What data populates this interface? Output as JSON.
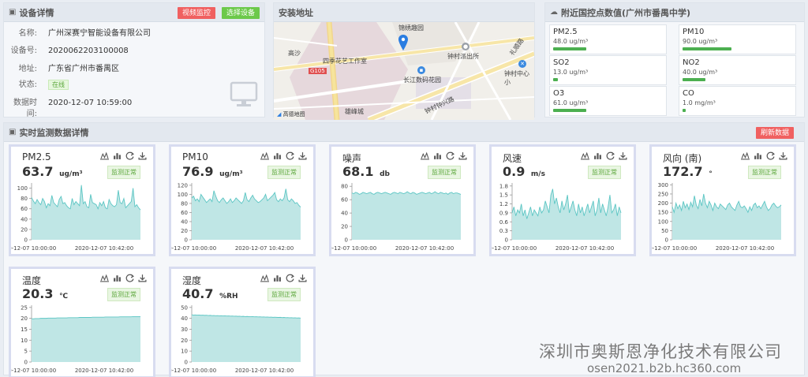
{
  "device": {
    "title": "设备详情",
    "btn_video": "视频监控",
    "btn_select": "选择设备",
    "rows": [
      {
        "label": "名称:",
        "value": "广州深赛宁智能设备有限公司"
      },
      {
        "label": "设备号:",
        "value": "2020062203100008"
      },
      {
        "label": "地址:",
        "value": "广东省广州市番禺区"
      },
      {
        "label": "状态:",
        "value": "在线"
      },
      {
        "label": "数据时间:",
        "value": "2020-12-07 10:59:00"
      }
    ]
  },
  "map": {
    "title": "安装地址",
    "labels": [
      "锦绣趣园",
      "高沙",
      "四季花艺工作室",
      "钟村派出所",
      "钟村中心小",
      "长江数码花园",
      "钟村钟兴路",
      "雄峰城",
      "礼顺路",
      "G105"
    ],
    "attribution": "高德地图"
  },
  "nearby": {
    "title": "附近国控点数值(广州市番禺中学)",
    "items": [
      {
        "name": "PM2.5",
        "value": "48.0 ug/m³",
        "level": 0.3
      },
      {
        "name": "PM10",
        "value": "90.0 ug/m³",
        "level": 0.44
      },
      {
        "name": "SO2",
        "value": "13.0 ug/m³",
        "level": 0.04
      },
      {
        "name": "NO2",
        "value": "40.0 ug/m³",
        "level": 0.21
      },
      {
        "name": "O3",
        "value": "61.0 ug/m³",
        "level": 0.3
      },
      {
        "name": "CO",
        "value": "1.0 mg/m³",
        "level": 0.03
      }
    ]
  },
  "realtime": {
    "title": "实时监测数据详情",
    "refresh_label": "刷新数据"
  },
  "colors": {
    "fill": "#bfe6e5",
    "line": "#5cc6c4",
    "accent_red": "#f06060",
    "accent_green": "#6cc94a"
  },
  "icons": [
    "line-chart-icon",
    "bar-chart-icon",
    "refresh-icon",
    "download-icon",
    "monitor-icon"
  ],
  "chart_data": [
    {
      "type": "area",
      "title": "PM2.5",
      "value": "63.7",
      "unit": "ug/m³",
      "status": "监测正常",
      "yticks": [
        0,
        20,
        40,
        60,
        80,
        100
      ],
      "ylim": [
        0,
        110
      ],
      "xticks": [
        "2020-12-07 10:00:00",
        "2020-12-07 10:42:00"
      ],
      "values": [
        82,
        75,
        70,
        78,
        72,
        68,
        80,
        74,
        62,
        70,
        66,
        86,
        72,
        68,
        64,
        78,
        84,
        70,
        72,
        66,
        62,
        60,
        80,
        68,
        74,
        70,
        66,
        106,
        70,
        74,
        64,
        62,
        88,
        72,
        70,
        68,
        60,
        72,
        66,
        74,
        62,
        60,
        78,
        70,
        66,
        64,
        68,
        96,
        72,
        70,
        80,
        62,
        66,
        70,
        74,
        100,
        64,
        68,
        62,
        58
      ]
    },
    {
      "type": "area",
      "title": "PM10",
      "value": "76.9",
      "unit": "ug/m³",
      "status": "监测正常",
      "yticks": [
        0,
        20,
        40,
        60,
        80,
        100,
        120
      ],
      "ylim": [
        0,
        125
      ],
      "xticks": [
        "2020-12-07 10:00:00",
        "2020-12-07 10:42:00"
      ],
      "values": [
        92,
        96,
        86,
        90,
        84,
        100,
        94,
        88,
        82,
        86,
        90,
        84,
        108,
        96,
        86,
        82,
        88,
        92,
        86,
        80,
        84,
        90,
        82,
        86,
        92,
        88,
        84,
        80,
        86,
        104,
        88,
        84,
        92,
        98,
        90,
        86,
        82,
        84,
        88,
        92,
        100,
        86,
        90,
        94,
        98,
        104,
        88,
        84,
        90,
        86,
        92,
        112,
        88,
        84,
        90,
        86,
        80,
        82,
        76,
        72
      ]
    },
    {
      "type": "area",
      "title": "噪声",
      "value": "68.1",
      "unit": "db",
      "status": "监测正常",
      "yticks": [
        0,
        20,
        40,
        60,
        80
      ],
      "ylim": [
        0,
        85
      ],
      "xticks": [
        "2020-12-07 10:00:00",
        "2020-12-07 10:42:00"
      ],
      "values": [
        70,
        69,
        71,
        70,
        68,
        69,
        71,
        70,
        69,
        70,
        71,
        69,
        68,
        70,
        71,
        70,
        69,
        70,
        71,
        70,
        69,
        68,
        70,
        71,
        70,
        69,
        71,
        70,
        69,
        70,
        72,
        70,
        69,
        71,
        70,
        68,
        69,
        70,
        71,
        70,
        69,
        70,
        71,
        69,
        70,
        72,
        70,
        69,
        71,
        70,
        69,
        70,
        68,
        70,
        71,
        69,
        70,
        70,
        69,
        68
      ]
    },
    {
      "type": "area",
      "title": "风速",
      "value": "0.9",
      "unit": "m/s",
      "status": "监测正常",
      "yticks": [
        0,
        0.3,
        0.6,
        0.9,
        1.2,
        1.5,
        1.8
      ],
      "ylim": [
        0,
        1.9
      ],
      "xticks": [
        "2020-12-07 10:00:00",
        "2020-12-07 10:42:00"
      ],
      "values": [
        0.9,
        1.1,
        0.8,
        1.0,
        0.9,
        1.2,
        0.8,
        1.0,
        0.7,
        0.9,
        1.1,
        0.8,
        1.0,
        0.9,
        0.8,
        1.1,
        0.9,
        1.0,
        1.3,
        1.1,
        0.9,
        1.5,
        1.7,
        1.2,
        1.4,
        1.1,
        0.9,
        1.3,
        1.0,
        1.2,
        1.5,
        0.9,
        1.1,
        1.3,
        1.0,
        0.8,
        1.2,
        0.9,
        1.1,
        0.8,
        1.0,
        1.2,
        0.9,
        1.1,
        1.3,
        0.8,
        1.0,
        1.4,
        0.9,
        1.2,
        1.0,
        0.8,
        1.1,
        1.5,
        0.9,
        1.0,
        1.2,
        0.8,
        1.1,
        0.9
      ]
    },
    {
      "type": "area",
      "title": "风向 (南)",
      "value": "172.7",
      "unit": "°",
      "status": "监测正常",
      "yticks": [
        0,
        50,
        100,
        150,
        200,
        250,
        300
      ],
      "ylim": [
        0,
        310
      ],
      "xticks": [
        "2020-12-07 10:00:00",
        "2020-12-07 10:42:00"
      ],
      "values": [
        180,
        150,
        200,
        170,
        190,
        160,
        210,
        175,
        195,
        165,
        205,
        180,
        240,
        190,
        170,
        220,
        185,
        250,
        200,
        175,
        210,
        190,
        160,
        200,
        180,
        170,
        195,
        185,
        175,
        165,
        190,
        200,
        180,
        170,
        160,
        190,
        210,
        180,
        175,
        185,
        170,
        150,
        180,
        160,
        190,
        200,
        175,
        185,
        170,
        190,
        210,
        180,
        160,
        170,
        190,
        200,
        185,
        175,
        180,
        190
      ]
    },
    {
      "type": "area",
      "title": "温度",
      "value": "20.3",
      "unit": "℃",
      "status": "监测正常",
      "yticks": [
        0,
        5,
        10,
        15,
        20,
        25
      ],
      "ylim": [
        0,
        26
      ],
      "xticks": [
        "2020-12-07 10:00:00",
        "2020-12-07 10:42:00"
      ],
      "values": [
        19.8,
        19.8,
        19.9,
        19.9,
        19.9,
        20.0,
        20.0,
        20.0,
        20.0,
        20.1,
        20.1,
        20.1,
        20.1,
        20.1,
        20.2,
        20.2,
        20.2,
        20.2,
        20.2,
        20.2,
        20.3,
        20.3,
        20.3,
        20.3,
        20.3,
        20.3,
        20.4,
        20.4,
        20.4,
        20.4,
        20.4,
        20.4,
        20.4,
        20.5,
        20.5,
        20.5,
        20.5,
        20.5,
        20.5,
        20.5,
        20.6,
        20.6,
        20.6,
        20.6,
        20.6,
        20.6,
        20.6,
        20.6,
        20.7,
        20.7,
        20.7,
        20.7,
        20.7,
        20.7,
        20.7,
        20.8,
        20.8,
        20.8,
        20.8,
        20.8
      ]
    },
    {
      "type": "area",
      "title": "湿度",
      "value": "40.7",
      "unit": "%RH",
      "status": "监测正常",
      "yticks": [
        0,
        10,
        20,
        30,
        40,
        50
      ],
      "ylim": [
        0,
        52
      ],
      "xticks": [
        "2020-12-07 10:00:00",
        "2020-12-07 10:42:00"
      ],
      "values": [
        43.2,
        43.0,
        43.1,
        42.9,
        43.0,
        42.8,
        42.9,
        42.7,
        42.8,
        42.6,
        42.7,
        42.5,
        42.6,
        42.4,
        42.5,
        42.3,
        42.4,
        42.2,
        42.3,
        42.1,
        42.2,
        42.0,
        42.1,
        41.9,
        42.0,
        41.8,
        41.9,
        41.7,
        41.8,
        41.6,
        41.7,
        41.6,
        41.5,
        41.6,
        41.4,
        41.5,
        41.3,
        41.4,
        41.2,
        41.3,
        41.1,
        41.2,
        41.0,
        41.1,
        40.9,
        41.0,
        40.9,
        40.8,
        40.9,
        40.7,
        40.8,
        40.6,
        40.7,
        40.5,
        40.6,
        40.4,
        40.5,
        40.3,
        40.4,
        40.2
      ]
    }
  ],
  "watermark": {
    "company": "深圳市奥斯恩净化技术有限公司",
    "site": "osen2021.b2b.hc360.com"
  }
}
